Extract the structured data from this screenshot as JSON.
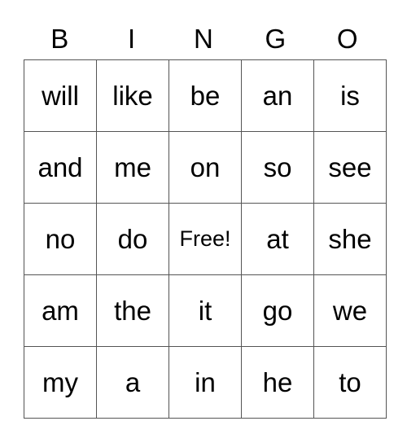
{
  "header": [
    "B",
    "I",
    "N",
    "G",
    "O"
  ],
  "rows": [
    [
      "will",
      "like",
      "be",
      "an",
      "is"
    ],
    [
      "and",
      "me",
      "on",
      "so",
      "see"
    ],
    [
      "no",
      "do",
      "Free!",
      "at",
      "she"
    ],
    [
      "am",
      "the",
      "it",
      "go",
      "we"
    ],
    [
      "my",
      "a",
      "in",
      "he",
      "to"
    ]
  ]
}
